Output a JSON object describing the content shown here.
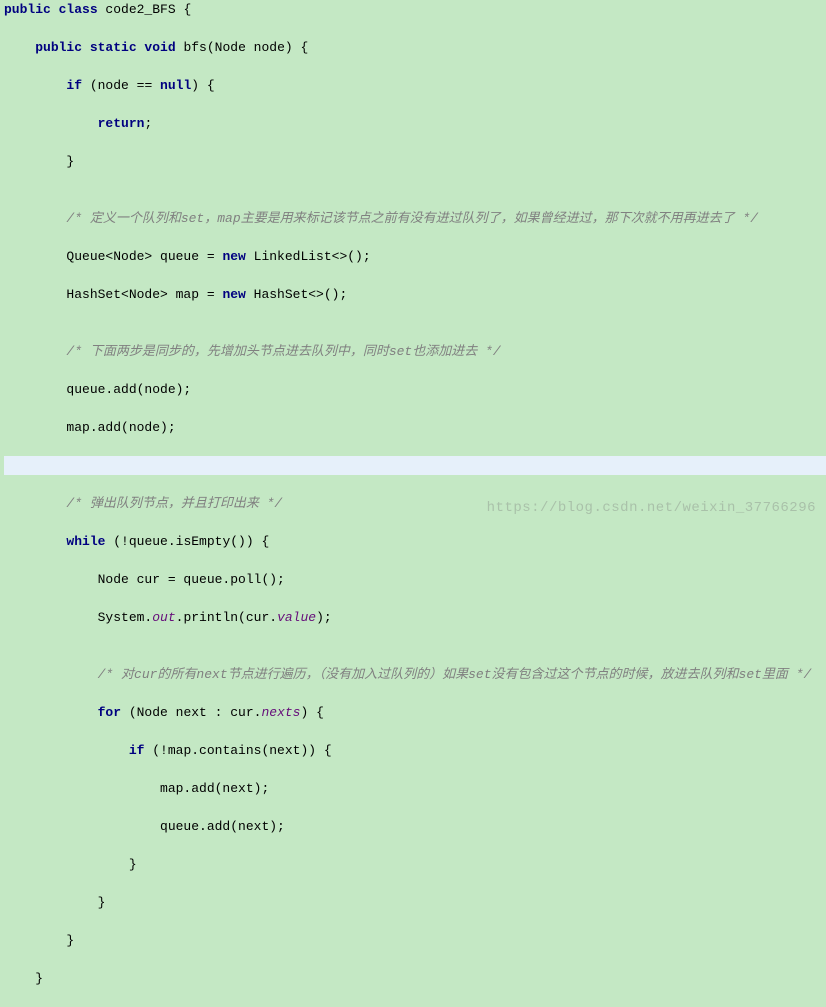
{
  "code": {
    "l0a": "public class",
    "l0b": " code2_BFS {",
    "l1a": "    ",
    "l1b": "public static void",
    "l1c": " bfs(Node node) {",
    "l2a": "        ",
    "l2b": "if",
    "l2c": " (node == ",
    "l2d": "null",
    "l2e": ") {",
    "l3a": "            ",
    "l3b": "return",
    "l3c": ";",
    "l4": "        }",
    "l5": "",
    "l6": "        /* 定义一个队列和set，map主要是用来标记该节点之前有没有进过队列了，如果曾经进过，那下次就不用再进去了 */",
    "l7a": "        Queue<Node> queue = ",
    "l7b": "new",
    "l7c": " LinkedList<>();",
    "l8a": "        HashSet<Node> map = ",
    "l8b": "new",
    "l8c": " HashSet<>();",
    "l9": "",
    "l10": "        /* 下面两步是同步的，先增加头节点进去队列中，同时set也添加进去 */",
    "l11": "        queue.add(node);",
    "l12": "        map.add(node);",
    "l13": "",
    "l14": "        /* 弹出队列节点，并且打印出来 */",
    "l15a": "        ",
    "l15b": "while",
    "l15c": " (!queue.isEmpty()) {",
    "l16": "            Node cur = queue.poll();",
    "l17a": "            System.",
    "l17b": "out",
    "l17c": ".println(cur.",
    "l17d": "value",
    "l17e": ");",
    "l18": "",
    "l19": "            /* 对cur的所有next节点进行遍历，（没有加入过队列的）如果set没有包含过这个节点的时候，放进去队列和set里面 */",
    "l20a": "            ",
    "l20b": "for",
    "l20c": " (Node next : cur.",
    "l20d": "nexts",
    "l20e": ") {",
    "l21a": "                ",
    "l21b": "if",
    "l21c": " (!map.contains(next)) {",
    "l22": "                    map.add(next);",
    "l23": "                    queue.add(next);",
    "l24": "                }",
    "l25": "            }",
    "l26": "        }",
    "l27": "    }"
  },
  "caret": "        ",
  "watermark": "https://blog.csdn.net/weixin_37766296"
}
